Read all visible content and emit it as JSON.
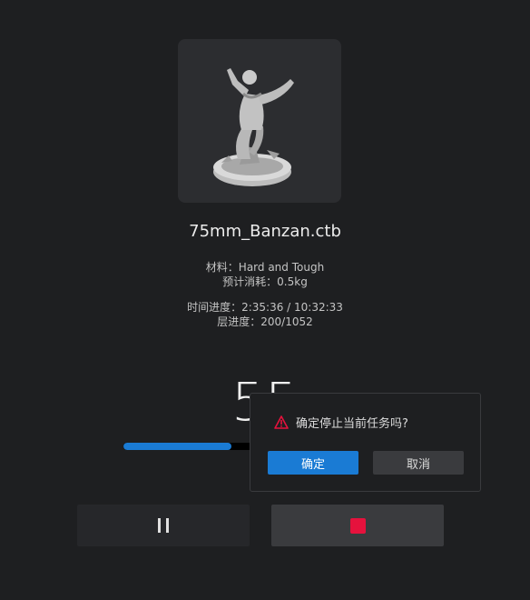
{
  "print": {
    "filename": "75mm_Banzan.ctb",
    "material_line": "材料：Hard and Tough",
    "consumption_line": "预计消耗：0.5kg",
    "time_line": "时间进度：2:35:36 / 10:32:33",
    "layer_line": "层进度：200/1052",
    "percent_text": "55",
    "progress_fraction": 0.38
  },
  "controls": {
    "pause_icon": "pause-icon",
    "stop_icon": "stop-icon"
  },
  "confirm_dialog": {
    "message": "确定停止当前任务吗?",
    "ok_label": "确定",
    "cancel_label": "取消"
  },
  "colors": {
    "accent": "#1a7bd4",
    "stop": "#e6123d",
    "warning": "#e6123d",
    "background": "#1e1f21"
  }
}
